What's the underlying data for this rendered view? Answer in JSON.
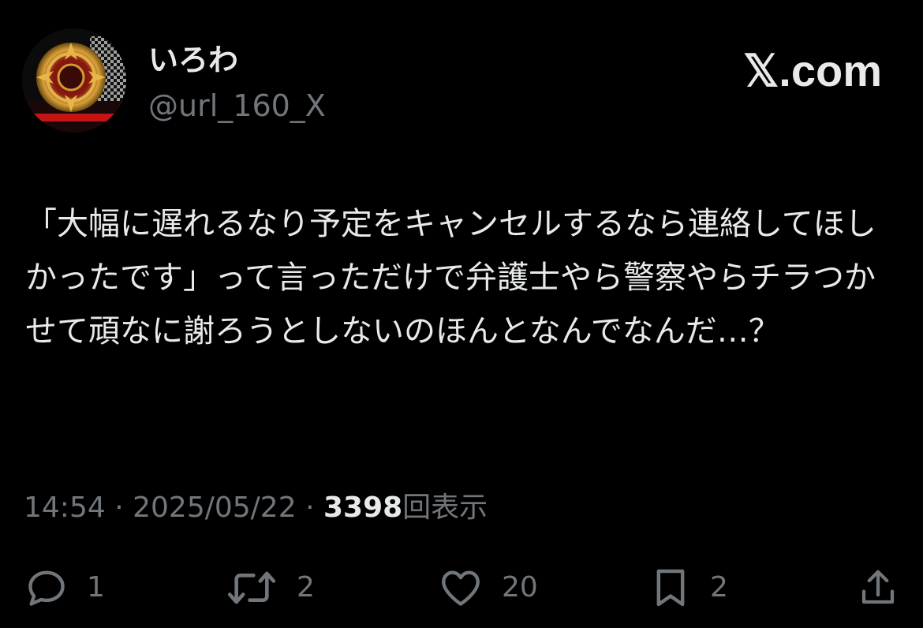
{
  "author": {
    "display_name": "いろわ",
    "handle": "@url_160_X",
    "avatar": "avatar-image"
  },
  "site": {
    "logo_text": "𝕏.com"
  },
  "tweet": {
    "text": "「大幅に遅れるなり予定をキャンセルするなら連絡してほしかったです」って言っただけで弁護士やら警察やらチラつかせて頑なに謝ろうとしないのほんとなんでなんだ…？",
    "time": "14:54",
    "separator": "·",
    "date": "2025/05/22",
    "views": "3398",
    "views_label": "回表示"
  },
  "actions": {
    "reply": {
      "icon": "reply-icon",
      "count": "1"
    },
    "retweet": {
      "icon": "retweet-icon",
      "count": "2"
    },
    "like": {
      "icon": "heart-icon",
      "count": "20"
    },
    "bookmark": {
      "icon": "bookmark-icon",
      "count": "2"
    },
    "share": {
      "icon": "share-icon"
    }
  },
  "colors": {
    "background": "#000000",
    "primary_text": "#e7e9ea",
    "secondary_text": "#71767b"
  }
}
